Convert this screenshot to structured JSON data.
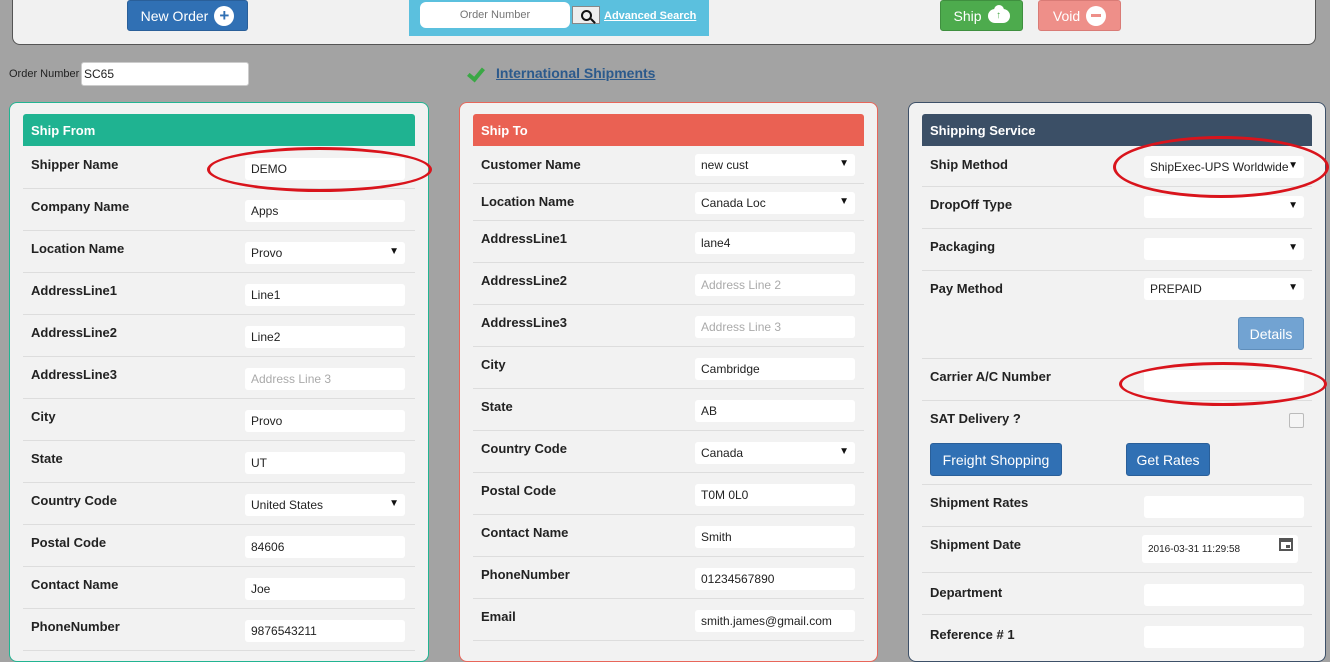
{
  "toolbar": {
    "new_order_label": "New Order",
    "search_placeholder": "Order Number",
    "advanced_search_label": "Advanced Search",
    "ship_label": "Ship",
    "void_label": "Void"
  },
  "order": {
    "label": "Order Number",
    "value": "SC65"
  },
  "international_link": "International Shipments",
  "ship_from": {
    "title": "Ship From",
    "rows": [
      {
        "label": "Shipper Name",
        "value": "DEMO",
        "type": "text"
      },
      {
        "label": "Company Name",
        "value": "Apps",
        "type": "text"
      },
      {
        "label": "Location Name",
        "value": "Provo",
        "type": "select"
      },
      {
        "label": "AddressLine1",
        "value": "Line1",
        "type": "text"
      },
      {
        "label": "AddressLine2",
        "value": "Line2",
        "type": "text"
      },
      {
        "label": "AddressLine3",
        "value": "Address Line 3",
        "type": "placeholder"
      },
      {
        "label": "City",
        "value": "Provo",
        "type": "text"
      },
      {
        "label": "State",
        "value": "UT",
        "type": "text"
      },
      {
        "label": "Country Code",
        "value": "United States",
        "type": "select"
      },
      {
        "label": "Postal Code",
        "value": "84606",
        "type": "text"
      },
      {
        "label": "Contact Name",
        "value": "Joe",
        "type": "text"
      },
      {
        "label": "PhoneNumber",
        "value": "9876543211",
        "type": "text"
      }
    ]
  },
  "ship_to": {
    "title": "Ship To",
    "rows": [
      {
        "label": "Customer Name",
        "value": "new cust",
        "type": "select"
      },
      {
        "label": "Location Name",
        "value": "Canada Loc",
        "type": "select"
      },
      {
        "label": "AddressLine1",
        "value": "lane4",
        "type": "text"
      },
      {
        "label": "AddressLine2",
        "value": "Address Line 2",
        "type": "placeholder"
      },
      {
        "label": "AddressLine3",
        "value": "Address Line 3",
        "type": "placeholder"
      },
      {
        "label": "City",
        "value": "Cambridge",
        "type": "text"
      },
      {
        "label": "State",
        "value": "AB",
        "type": "text"
      },
      {
        "label": "Country Code",
        "value": "Canada",
        "type": "select"
      },
      {
        "label": "Postal Code",
        "value": "T0M 0L0",
        "type": "text"
      },
      {
        "label": "Contact Name",
        "value": "Smith",
        "type": "text"
      },
      {
        "label": "PhoneNumber",
        "value": "01234567890",
        "type": "text"
      },
      {
        "label": "Email",
        "value": "smith.james@gmail.com",
        "type": "text"
      }
    ]
  },
  "shipping_service": {
    "title": "Shipping Service",
    "ship_method": {
      "label": "Ship Method",
      "value": "ShipExec-UPS Worldwide"
    },
    "dropoff_type": {
      "label": "DropOff Type",
      "value": ""
    },
    "packaging": {
      "label": "Packaging",
      "value": ""
    },
    "pay_method": {
      "label": "Pay Method",
      "value": "PREPAID"
    },
    "details_label": "Details",
    "carrier_ac": {
      "label": "Carrier A/C Number",
      "value": ""
    },
    "sat_delivery": {
      "label": "SAT Delivery ?"
    },
    "freight_shopping_label": "Freight Shopping",
    "get_rates_label": "Get Rates",
    "shipment_rates": {
      "label": "Shipment Rates",
      "value": ""
    },
    "shipment_date": {
      "label": "Shipment Date",
      "value": "2016-03-31 11:29:58"
    },
    "department": {
      "label": "Department",
      "value": ""
    },
    "reference1": {
      "label": "Reference # 1",
      "value": ""
    }
  },
  "colors": {
    "ship_from_accent": "#1fb391",
    "ship_to_accent": "#ea6153",
    "shipping_service_accent": "#3b4f66",
    "annotation": "#d9141c"
  }
}
